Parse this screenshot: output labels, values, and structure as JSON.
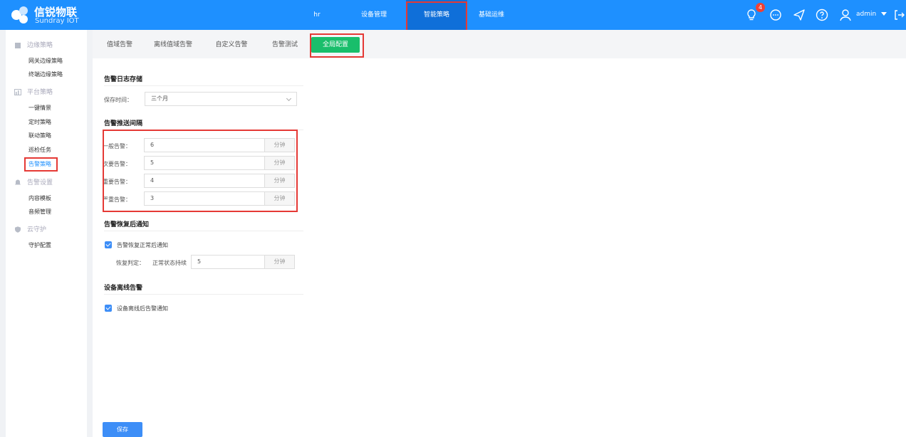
{
  "brand": {
    "name_cn": "信锐物联",
    "name_en": "Sundray IOT"
  },
  "topnav": {
    "items": [
      {
        "label": "hr"
      },
      {
        "label": "设备管理"
      },
      {
        "label": "智能策略"
      },
      {
        "label": "基础运维"
      }
    ],
    "active_index": 2
  },
  "header": {
    "notification_count": "4",
    "user": "admin",
    "icons": [
      "bulb-icon",
      "chat-icon",
      "send-icon",
      "help-icon",
      "user-icon",
      "logout-icon"
    ]
  },
  "sidebar": {
    "groups": [
      {
        "label": "边缘策略",
        "icon": "building-icon",
        "items": [
          "网关边缘策略",
          "终端边缘策略"
        ]
      },
      {
        "label": "平台策略",
        "icon": "chart-icon",
        "items": [
          "一键情景",
          "定时策略",
          "联动策略",
          "巡检任务",
          "告警策略"
        ]
      },
      {
        "label": "告警设置",
        "icon": "bell-icon",
        "items": [
          "内容模板",
          "音频管理"
        ]
      },
      {
        "label": "云守护",
        "icon": "shield-icon",
        "items": [
          "守护配置"
        ]
      }
    ],
    "active_item": "告警策略"
  },
  "tabs": {
    "items": [
      "值域告警",
      "离线值域告警",
      "自定义告警",
      "告警测试",
      "全局配置"
    ],
    "active_index": 4
  },
  "log_storage": {
    "title": "告警日志存储",
    "retention_label": "保存时间：",
    "retention_value": "三个月"
  },
  "push_interval": {
    "title": "告警推送间隔",
    "unit": "分钟",
    "rows": [
      {
        "label": "一般告警：",
        "value": "6"
      },
      {
        "label": "次要告警：",
        "value": "5"
      },
      {
        "label": "重要告警：",
        "value": "4"
      },
      {
        "label": "严重告警：",
        "value": "3"
      }
    ]
  },
  "recovery": {
    "title": "告警恢复后通知",
    "checkbox_label": "告警恢复正常后通知",
    "checked": true,
    "judge_label": "恢复判定：",
    "duration_label": "正常状态持续",
    "duration_value": "5",
    "unit": "分钟"
  },
  "offline": {
    "title": "设备离线告警",
    "checkbox_label": "设备离线后告警通知",
    "checked": true
  },
  "actions": {
    "save_label": "保存"
  },
  "colors": {
    "header": "#1e90ff",
    "active_tab": "#19be6b",
    "primary": "#3d8ef7",
    "highlight": "#e53935"
  }
}
